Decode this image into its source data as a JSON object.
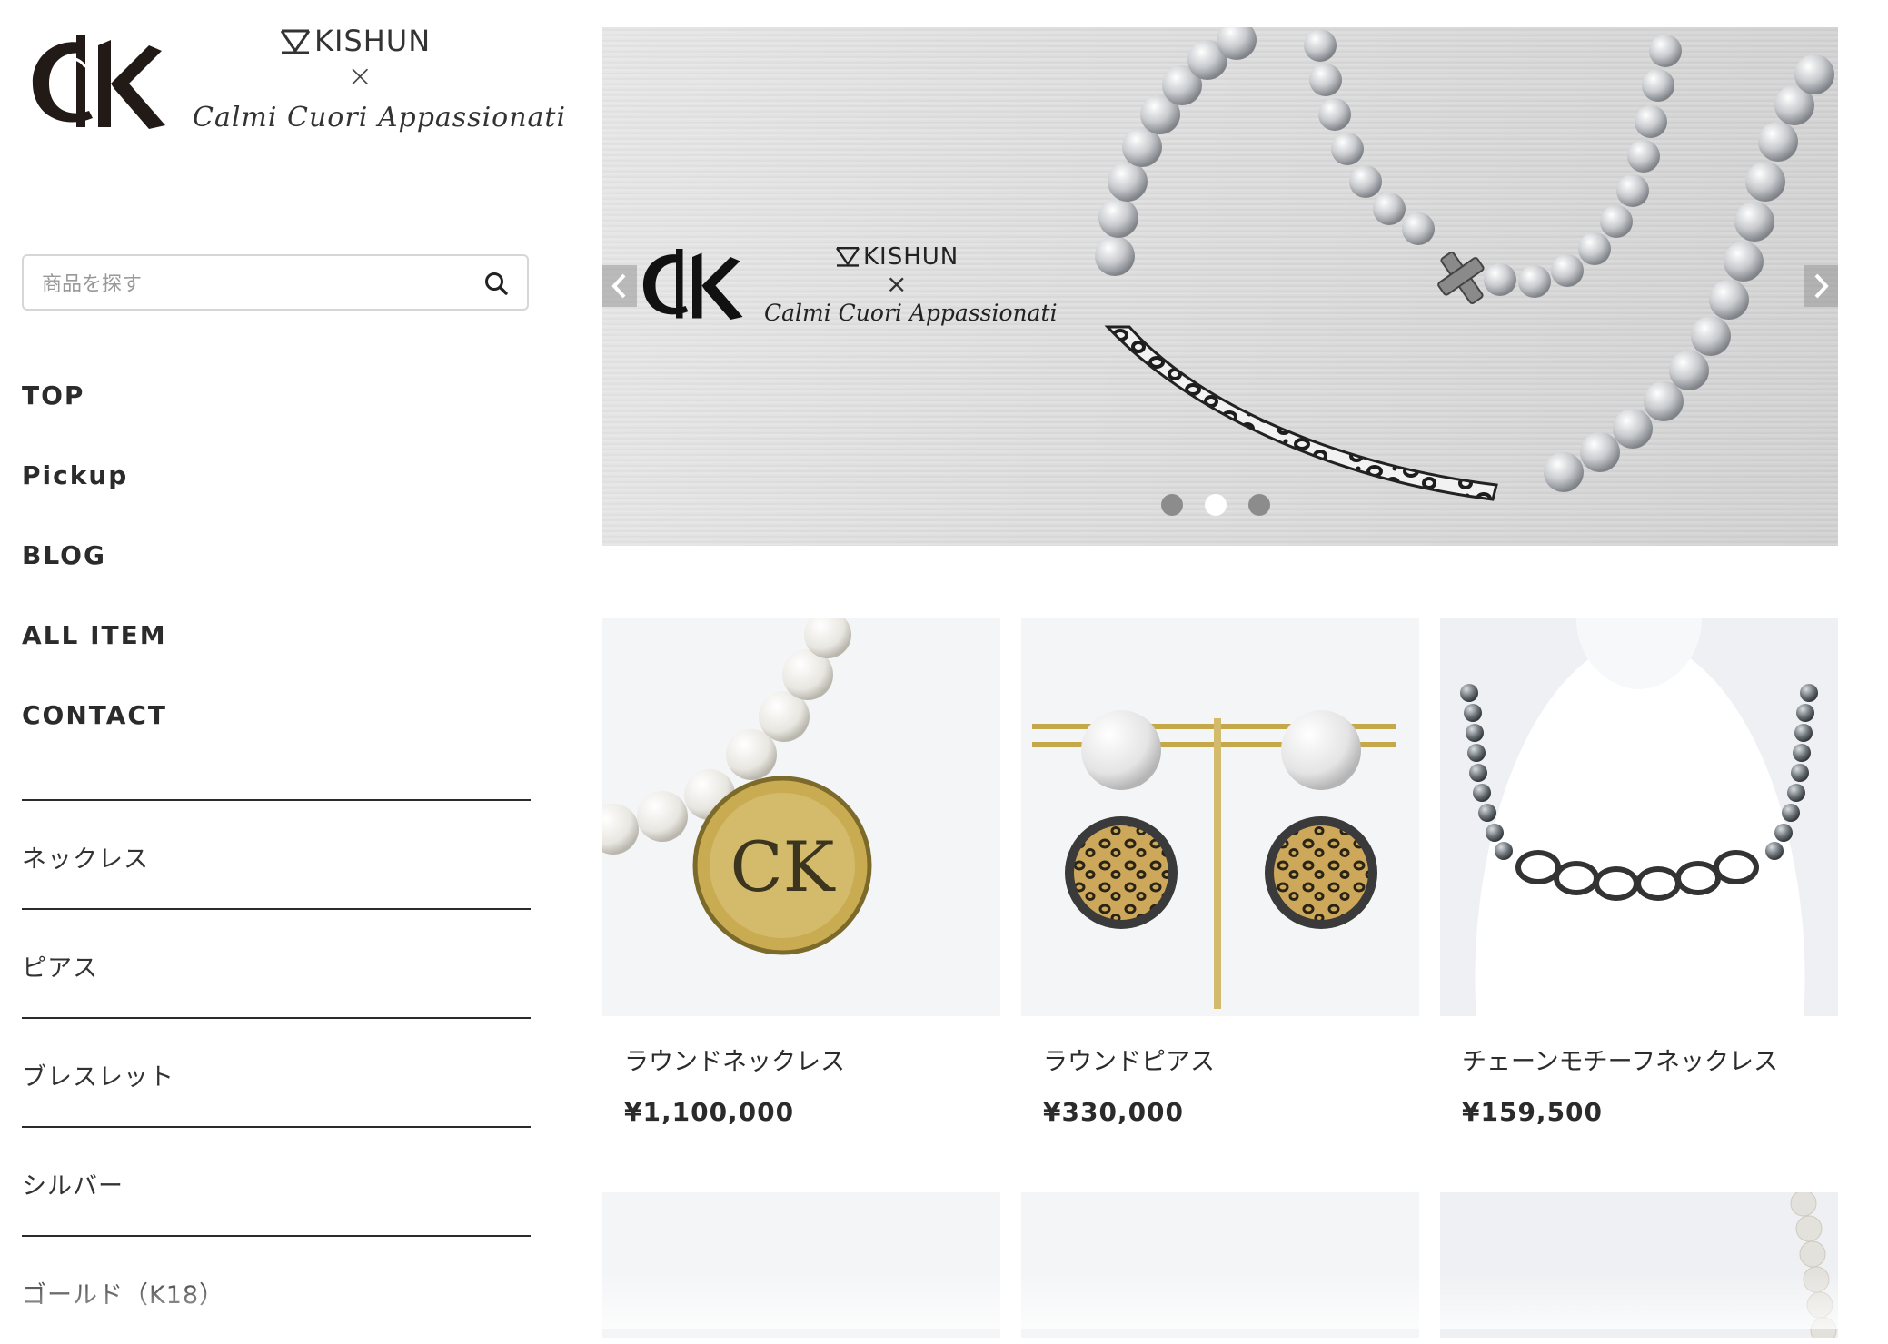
{
  "brand": {
    "monogram": "CK",
    "kishun": "KISHUN",
    "cross": "×",
    "script": "Calmi Cuori Appassionati"
  },
  "search": {
    "placeholder": "商品を探す",
    "icon": "search-icon"
  },
  "main_nav": [
    {
      "label": "TOP"
    },
    {
      "label": "Pickup"
    },
    {
      "label": "BLOG"
    },
    {
      "label": "ALL ITEM"
    },
    {
      "label": "CONTACT"
    }
  ],
  "categories": [
    {
      "label": "ネックレス"
    },
    {
      "label": "ピアス"
    },
    {
      "label": "ブレスレット"
    },
    {
      "label": "シルバー"
    },
    {
      "label": "ゴールド（K18）"
    }
  ],
  "slider": {
    "dots": 3,
    "active_dot": 2,
    "prev_icon": "chevron-left-icon",
    "next_icon": "chevron-right-icon"
  },
  "products": [
    {
      "name": "ラウンドネックレス",
      "price": "¥1,100,000"
    },
    {
      "name": "ラウンドピアス",
      "price": "¥330,000"
    },
    {
      "name": "チェーンモチーフネックレス",
      "price": "¥159,500"
    }
  ],
  "colors": {
    "text": "#2b2b2b",
    "border": "#d6d6d6",
    "slider_bg": "#dcdcdc"
  }
}
